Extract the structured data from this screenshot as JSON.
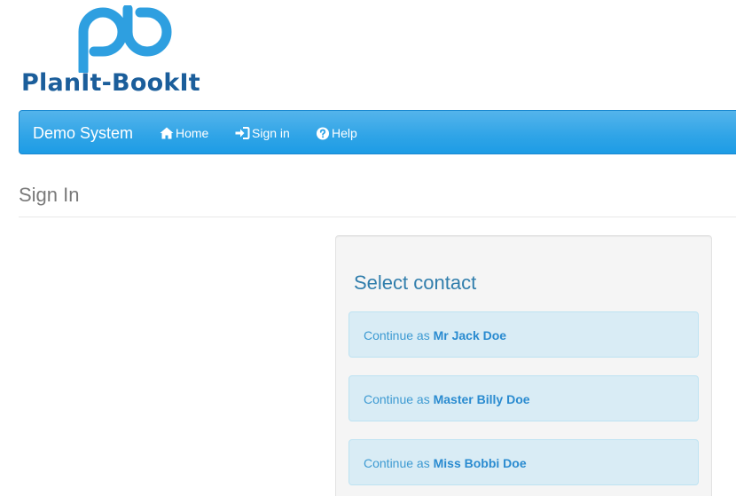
{
  "logo": {
    "text": "PlanIt-BookIt",
    "mark_icon": "pb-logo-mark",
    "colors": {
      "mark": "#2e9fe0",
      "text": "#1b5e9b"
    }
  },
  "navbar": {
    "brand": "Demo System",
    "items": [
      {
        "label": "Home",
        "icon": "home-icon"
      },
      {
        "label": "Sign in",
        "icon": "sign-in-icon"
      },
      {
        "label": "Help",
        "icon": "question-circle-icon"
      }
    ],
    "colors": {
      "background": "#2fa4e7",
      "text": "#ffffff"
    }
  },
  "page": {
    "title": "Sign In"
  },
  "contact_panel": {
    "title": "Select contact",
    "options": [
      {
        "prefix": "Continue as ",
        "name": "Mr Jack Doe"
      },
      {
        "prefix": "Continue as ",
        "name": "Master Billy Doe"
      },
      {
        "prefix": "Continue as ",
        "name": "Miss Bobbi Doe"
      }
    ],
    "colors": {
      "option_background": "#d9ecf5",
      "option_text": "#3d9ad2",
      "title": "#317eac"
    }
  }
}
